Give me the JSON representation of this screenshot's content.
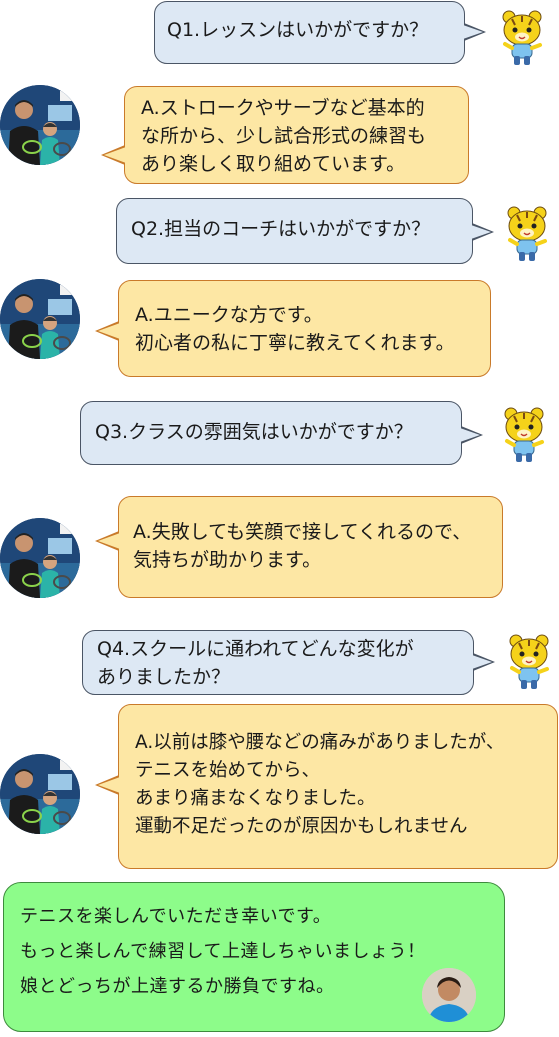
{
  "qa": [
    {
      "question": [
        "Q1.レッスンはいかがですか？"
      ],
      "answer": [
        "A.ストロークやサーブなど基本的",
        "な所から、少し試合形式の練習も",
        "あり楽しく取り組めています。"
      ]
    },
    {
      "question": [
        "Q2.担当のコーチはいかがですか？"
      ],
      "answer": [
        "A.ユニークな方です。",
        "初心者の私に丁寧に教えてくれます。"
      ]
    },
    {
      "question": [
        "Q3.クラスの雰囲気はいかがですか？"
      ],
      "answer": [
        "A.失敗しても笑顔で接してくれるので、",
        "気持ちが助かります。"
      ]
    },
    {
      "question": [
        "Q4.スクールに通われてどんな変化が",
        "ありましたか？"
      ],
      "answer": [
        "A.以前は膝や腰などの痛みがありましたが、",
        "テニスを始めてから、",
        "あまり痛まなくなりました。",
        "運動不足だったのが原因かもしれません"
      ]
    }
  ],
  "closing": {
    "lines": [
      "テニスを楽しんでいただき幸いです。",
      "もっと楽しんで練習して上達しちゃいましょう！",
      "娘とどっちが上達するか勝負ですね。"
    ]
  },
  "colors": {
    "question_bg": "#dde8f4",
    "answer_bg": "#fde7a4",
    "closing_bg": "#8dfc8a"
  }
}
